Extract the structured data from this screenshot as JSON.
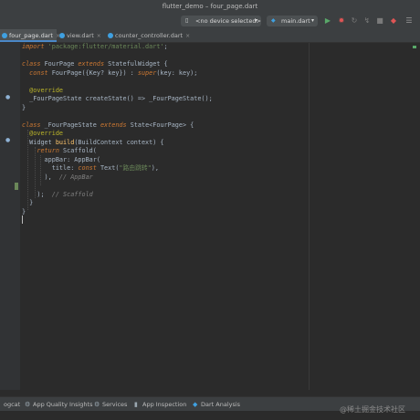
{
  "window": {
    "title": "flutter_demo – four_page.dart"
  },
  "toolbar": {
    "device_selector": "<no device selected>",
    "run_config": "main.dart",
    "colors": {
      "run": "#59a869",
      "stop": "#e05555",
      "accent": "#4a88c7"
    }
  },
  "tabs": [
    {
      "label": "four_page.dart",
      "active": true
    },
    {
      "label": "view.dart",
      "active": false
    },
    {
      "label": "counter_controller.dart",
      "active": false
    }
  ],
  "code": {
    "l1": {
      "a": "import ",
      "b": "'package:flutter/material.dart'",
      "c": ";"
    },
    "l3": {
      "a": "class ",
      "b": "FourPage ",
      "c": "extends ",
      "d": "StatefulWidget {"
    },
    "l4": {
      "a": "  const ",
      "b": "FourPage({Key? key}) : ",
      "c": "super",
      "d": "(key: key);"
    },
    "l6": {
      "a": "  @override"
    },
    "l7": {
      "a": "  _FourPageState createState() => _FourPageState();"
    },
    "l8": {
      "a": "}"
    },
    "l10": {
      "a": "class ",
      "b": "_FourPageState ",
      "c": "extends ",
      "d": "State<FourPage> {"
    },
    "l11": {
      "a": "  @override"
    },
    "l12": {
      "a": "  Widget ",
      "b": "build",
      "c": "(BuildContext context) {"
    },
    "l13": {
      "a": "    return ",
      "b": "Scaffold("
    },
    "l14": {
      "a": "      appBar: ",
      "b": "AppBar("
    },
    "l15": {
      "a": "        title: ",
      "b": "const ",
      "c": "Text(",
      "d": "\"路由跳转\"",
      "e": "),"
    },
    "l16": {
      "a": "      ),  ",
      "b": "// AppBar"
    },
    "l18": {
      "a": "    );  ",
      "b": "// Scaffold"
    },
    "l19": {
      "a": "  }"
    },
    "l20": {
      "a": "}"
    }
  },
  "statusbar": [
    {
      "label": "ogcat",
      "icon": "logcat-icon"
    },
    {
      "label": "App Quality Insights",
      "icon": "quality-icon"
    },
    {
      "label": "Services",
      "icon": "services-icon"
    },
    {
      "label": "App Inspection",
      "icon": "inspection-icon"
    },
    {
      "label": "Dart Analysis",
      "icon": "dart-icon"
    }
  ],
  "watermark": "@稀土掘金技术社区"
}
